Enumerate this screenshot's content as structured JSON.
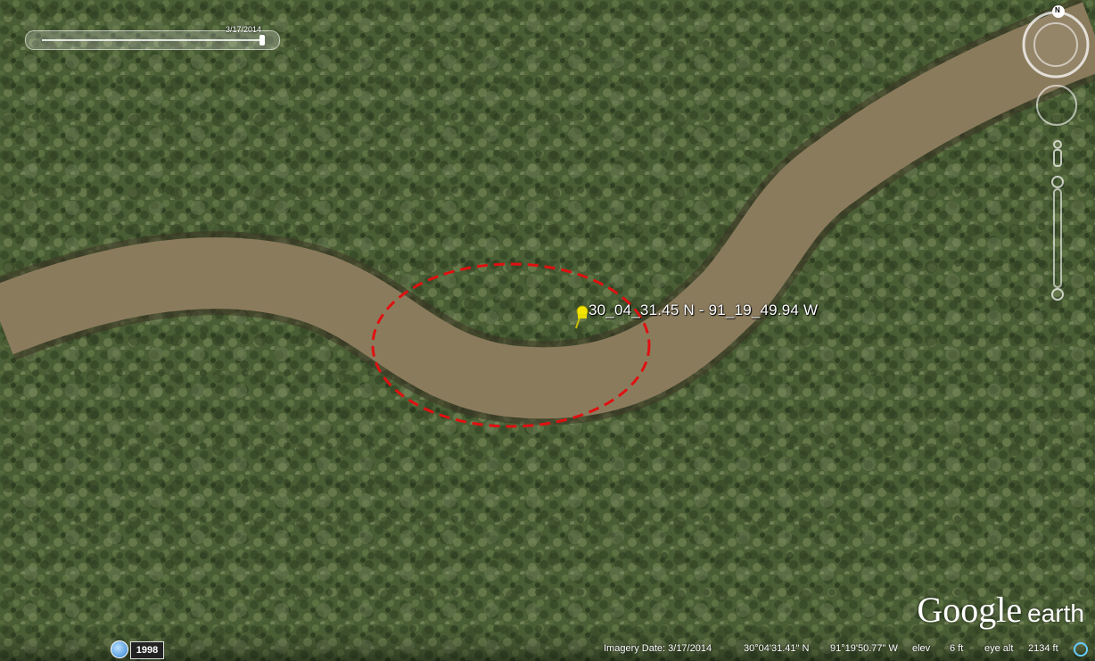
{
  "timeslider": {
    "date": "3/17/2014"
  },
  "placemark": {
    "label": "30_04_31.45 N - 91_19_49.94 W"
  },
  "logo": {
    "google": "Google",
    "earth": "earth"
  },
  "statusbar": {
    "historical_year": "1998",
    "imagery_date": "Imagery Date: 3/17/2014",
    "latitude": "30°04'31.41\" N",
    "longitude": "91°19'50.77\" W",
    "elev_label": "elev",
    "elev_value": "6 ft",
    "eye_alt_label": "eye alt",
    "eye_alt_value": "2134 ft"
  },
  "compass": {
    "north": "N"
  },
  "icons": [
    "compass-ring-icon",
    "look-joystick-icon",
    "street-view-pegman-icon",
    "zoom-slider-icon",
    "placemark-pushpin-icon",
    "historical-imagery-clock-icon",
    "streaming-indicator-icon"
  ],
  "colors": {
    "river": "#8a7a5c",
    "forest": "#4a6036",
    "highlight_ellipse": "#e01010",
    "pushpin": "#f2e600"
  }
}
